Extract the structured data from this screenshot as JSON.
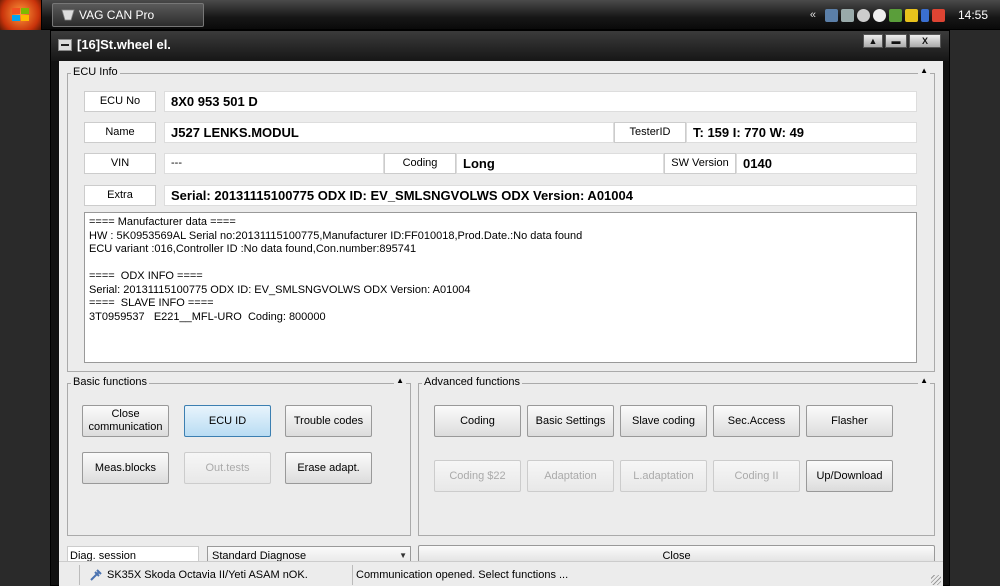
{
  "taskbar": {
    "app_button_label": "VAG CAN Pro",
    "chevron": "«",
    "clock": "14:55",
    "tray_icons": [
      "network-icon",
      "volume-icon",
      "antivirus-icon",
      "power-icon",
      "app-icon",
      "update-icon",
      "battery-icon",
      "flag-icon"
    ]
  },
  "window": {
    "title": "[16]St.wheel el.",
    "controls": [
      "▲",
      "▬",
      "X"
    ]
  },
  "ecu_info": {
    "group_title": "ECU Info",
    "ecu_no_label": "ECU No",
    "ecu_no_value": "8X0 953 501 D",
    "name_label": "Name",
    "name_value": "J527  LENKS.MODUL",
    "tester_id_label": "TesterID",
    "tester_id_value": "T: 159 I: 770 W: 49",
    "vin_label": "VIN",
    "vin_value": "---",
    "coding_label": "Coding",
    "coding_value": "Long",
    "sw_version_label": "SW Version",
    "sw_version_value": "0140",
    "extra_label": "Extra",
    "extra_value": "Serial: 20131115100775 ODX ID: EV_SMLSNGVOLWS ODX Version: A01004",
    "details": "==== Manufacturer data ====\nHW : 5K0953569AL Serial no:20131115100775,Manufacturer ID:FF010018,Prod.Date.:No data found\nECU variant :016,Controller ID :No data found,Con.number:895741\n\n====  ODX INFO ====\nSerial: 20131115100775 ODX ID: EV_SMLSNGVOLWS ODX Version: A01004\n====  SLAVE INFO ====\n3T0959537   E221__MFL-URO  Coding: 800000"
  },
  "basic_functions": {
    "group_title": "Basic functions",
    "close_communication": "Close communication",
    "ecu_id": "ECU ID",
    "trouble_codes": "Trouble codes",
    "meas_blocks": "Meas.blocks",
    "out_tests": "Out.tests",
    "erase_adapt": "Erase adapt."
  },
  "advanced_functions": {
    "group_title": "Advanced functions",
    "coding": "Coding",
    "basic_settings": "Basic Settings",
    "slave_coding": "Slave coding",
    "sec_access": "Sec.Access",
    "flasher": "Flasher",
    "coding_22": "Coding $22",
    "adaptation": "Adaptation",
    "l_adaptation": "L.adaptation",
    "coding_ii": "Coding II",
    "up_download": "Up/Download"
  },
  "session": {
    "label": "Diag. session",
    "selected": "Standard Diagnose",
    "close_button": "Close"
  },
  "statusbar": {
    "vehicle": "SK35X Skoda Octavia II/Yeti ASAM nOK.",
    "message": "Communication opened. Select functions ..."
  }
}
